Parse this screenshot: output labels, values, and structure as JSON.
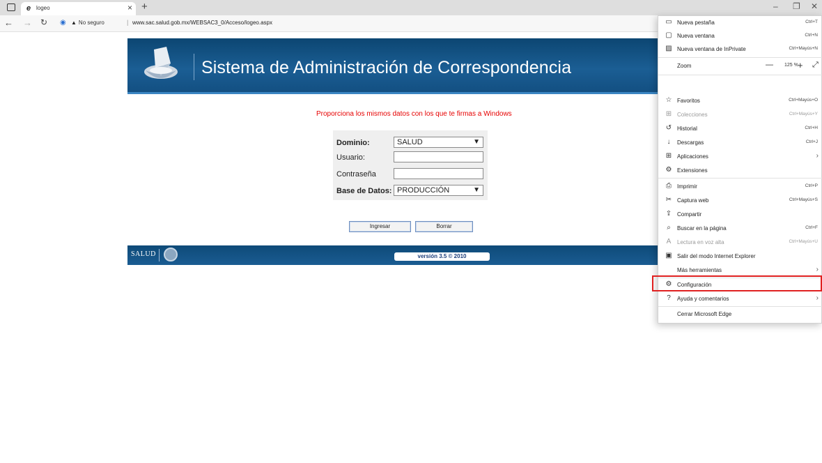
{
  "tab": {
    "title": "logeo",
    "favicon": "e"
  },
  "address": {
    "security": "No seguro",
    "url": "www.sac.salud.gob.mx/WEBSAC3_0/Acceso/logeo.aspx"
  },
  "banner": {
    "title": "Sistema de Administración de Correspondencia"
  },
  "instruction": "Proporciona los mismos datos con los que te firmas a Windows",
  "form": {
    "domain_label": "Dominio:",
    "domain_value": "SALUD",
    "user_label": "Usuario:",
    "user_value": "",
    "password_label": "Contraseña",
    "password_value": "",
    "db_label": "Base de Datos:",
    "db_value": "PRODUCCIÓN"
  },
  "buttons": {
    "login": "Ingresar",
    "clear": "Borrar"
  },
  "footer": {
    "logo": "SALUD",
    "version": "versión 3.5 © 2010"
  },
  "menu": {
    "items": [
      {
        "label": "Nueva pestaña",
        "shortcut": "Ctrl+T",
        "icon": "new-tab-icon"
      },
      {
        "label": "Nueva ventana",
        "shortcut": "Ctrl+N",
        "icon": "new-window-icon"
      },
      {
        "label": "Nueva ventana de InPrivate",
        "shortcut": "Ctrl+Mayús+N",
        "icon": "inprivate-icon"
      },
      {
        "label": "Zoom",
        "value": "125 %"
      },
      {
        "label": "Favoritos",
        "shortcut": "Ctrl+Mayús+O",
        "icon": "favorites-icon"
      },
      {
        "label": "Colecciones",
        "shortcut": "Ctrl+Mayús+Y",
        "icon": "collections-icon",
        "disabled": true
      },
      {
        "label": "Historial",
        "shortcut": "Ctrl+H",
        "icon": "history-icon"
      },
      {
        "label": "Descargas",
        "shortcut": "Ctrl+J",
        "icon": "downloads-icon"
      },
      {
        "label": "Aplicaciones",
        "icon": "apps-icon",
        "submenu": true
      },
      {
        "label": "Extensiones",
        "icon": "extensions-icon"
      },
      {
        "label": "Imprimir",
        "shortcut": "Ctrl+P",
        "icon": "print-icon"
      },
      {
        "label": "Captura web",
        "shortcut": "Ctrl+Mayús+S",
        "icon": "web-capture-icon"
      },
      {
        "label": "Compartir",
        "icon": "share-icon"
      },
      {
        "label": "Buscar en la página",
        "shortcut": "Ctrl+F",
        "icon": "find-icon"
      },
      {
        "label": "Lectura en voz alta",
        "shortcut": "Ctrl+Mayús+U",
        "icon": "read-aloud-icon",
        "disabled": true
      },
      {
        "label": "Salir del modo Internet Explorer",
        "icon": "ie-mode-icon"
      },
      {
        "label": "Más herramientas",
        "submenu": true
      },
      {
        "label": "Configuración",
        "icon": "settings-icon"
      },
      {
        "label": "Ayuda y comentarios",
        "icon": "help-icon",
        "submenu": true
      },
      {
        "label": "Cerrar Microsoft Edge"
      }
    ]
  },
  "colors": {
    "banner": "#1b5e94",
    "instruction": "#e60000",
    "highlight": "#e02020"
  }
}
